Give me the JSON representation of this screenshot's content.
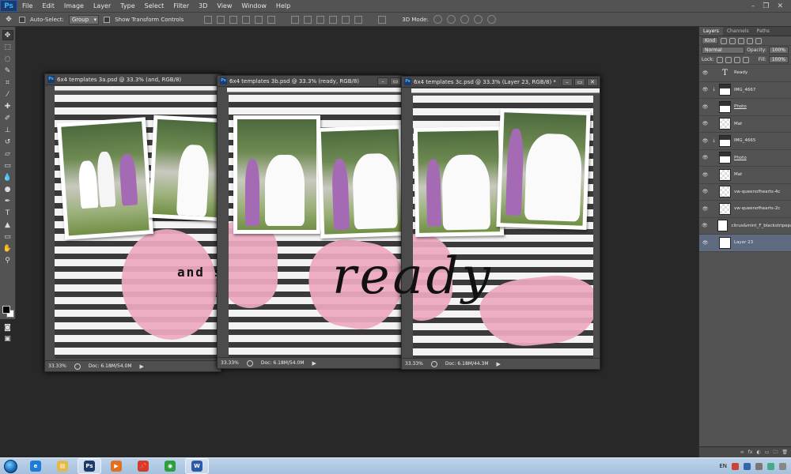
{
  "app": {
    "logo": "Ps",
    "menu": [
      "File",
      "Edit",
      "Image",
      "Layer",
      "Type",
      "Select",
      "Filter",
      "3D",
      "View",
      "Window",
      "Help"
    ],
    "window_controls": [
      "–",
      "❐",
      "✕"
    ]
  },
  "options_bar": {
    "auto_select_label": "Auto-Select:",
    "auto_select_value": "Group",
    "show_transform_label": "Show Transform Controls",
    "mode_3d_label": "3D Mode:"
  },
  "documents": [
    {
      "title": "6x4 templates 3a.psd @ 33.3% (and, RGB/8)",
      "zoom": "33.33%",
      "doc_info": "Doc: 6.18M/54.0M"
    },
    {
      "title": "6x4 templates 3b.psd @ 33.3% (ready, RGB/8)",
      "zoom": "33.33%",
      "doc_info": "Doc: 6.18M/54.0M"
    },
    {
      "title": "6x4 templates 3c.psd @ 33.3% (Layer 23, RGB/8) *",
      "zoom": "33.33%",
      "doc_info": "Doc: 6.18M/44.3M"
    }
  ],
  "canvas_text": {
    "stamp": "and  she is",
    "script": "ready"
  },
  "colors": {
    "heart": "#eda8be",
    "stripe_dark": "#3a3a3a",
    "stripe_light": "#f3f3f3",
    "dress": "#a46bb4",
    "workspace": "#282828",
    "selected_layer": "#5d6a80"
  },
  "layers_panel": {
    "tabs": [
      "Layers",
      "Channels",
      "Paths"
    ],
    "filter_kind": "Kind",
    "blend_mode": "Normal",
    "opacity_label": "Opacity:",
    "opacity_value": "100%",
    "lock_label": "Lock:",
    "fill_label": "Fill:",
    "fill_value": "100%",
    "layers": [
      {
        "name": "Ready",
        "thumb": "text",
        "clipped": false,
        "underlined": false,
        "selected": false
      },
      {
        "name": "IMG_4667",
        "thumb": "photo",
        "clipped": true,
        "underlined": false,
        "selected": false
      },
      {
        "name": "Photo",
        "thumb": "photo-frame",
        "clipped": false,
        "underlined": true,
        "selected": false
      },
      {
        "name": "Mat",
        "thumb": "checker",
        "clipped": false,
        "underlined": false,
        "selected": false
      },
      {
        "name": "IMG_4665",
        "thumb": "photo",
        "clipped": true,
        "underlined": false,
        "selected": false
      },
      {
        "name": "Photo",
        "thumb": "photo-frame",
        "clipped": false,
        "underlined": true,
        "selected": false
      },
      {
        "name": "Mat",
        "thumb": "checker",
        "clipped": false,
        "underlined": false,
        "selected": false
      },
      {
        "name": "vw-queenofhearts-4c",
        "thumb": "checker",
        "clipped": false,
        "underlined": false,
        "selected": false
      },
      {
        "name": "vw-queenofhearts-2c",
        "thumb": "checker",
        "clipped": false,
        "underlined": false,
        "selected": false
      },
      {
        "name": "citrus&mint_F_blackstripepaper",
        "thumb": "white",
        "clipped": false,
        "underlined": false,
        "selected": false
      },
      {
        "name": "Layer 23",
        "thumb": "white",
        "clipped": false,
        "underlined": false,
        "selected": true
      }
    ],
    "footer_icons": [
      "∞",
      "fx",
      "◐",
      "▭",
      "🗀",
      "🗑"
    ]
  },
  "taskbar": {
    "apps": [
      {
        "name": "ie",
        "glyph": "e",
        "color": "#1e7bd6"
      },
      {
        "name": "explorer",
        "glyph": "▤",
        "color": "#e3b94a"
      },
      {
        "name": "photoshop",
        "glyph": "Ps",
        "color": "#1c3a6b"
      },
      {
        "name": "media-player",
        "glyph": "▶",
        "color": "#e2701f"
      },
      {
        "name": "pin-app",
        "glyph": "📌",
        "color": "#d63a2a"
      },
      {
        "name": "chrome",
        "glyph": "◉",
        "color": "#2e9e3f"
      },
      {
        "name": "word",
        "glyph": "W",
        "color": "#2a5aa8"
      }
    ],
    "language": "EN"
  }
}
